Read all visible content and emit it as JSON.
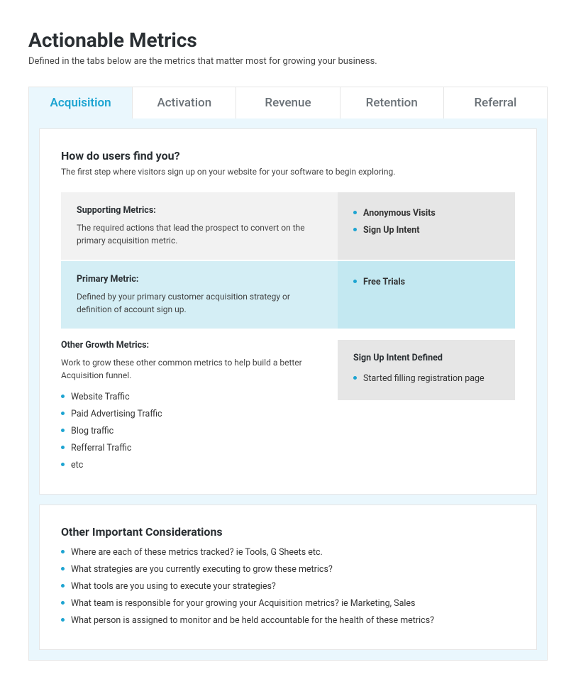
{
  "header": {
    "title": "Actionable Metrics",
    "subtitle": "Defined in the tabs below are the metrics that matter most for growing your business."
  },
  "tabs": [
    {
      "label": "Acquisition",
      "active": true
    },
    {
      "label": "Activation",
      "active": false
    },
    {
      "label": "Revenue",
      "active": false
    },
    {
      "label": "Retention",
      "active": false
    },
    {
      "label": "Referral",
      "active": false
    }
  ],
  "panel1": {
    "heading": "How do users find you?",
    "desc": "The first step where visitors sign up on your website for your software to begin exploring.",
    "supporting": {
      "label": "Supporting Metrics:",
      "text": "The required actions that lead the prospect to convert on the primary acquisition metric.",
      "items": [
        "Anonymous Visits",
        "Sign Up Intent"
      ]
    },
    "primary": {
      "label": "Primary Metric:",
      "text": "Defined by your primary customer acquisition strategy or definition of account sign up.",
      "items": [
        "Free Trials"
      ]
    },
    "growth": {
      "label": "Other Growth Metrics:",
      "text": "Work to grow these other common metrics to help build a better Acquisition funnel.",
      "items": [
        "Website Traffic",
        "Paid Advertising Traffic",
        "Blog traffic",
        "Refferral Traffic",
        "etc"
      ]
    },
    "defined": {
      "label": "Sign Up Intent Defined",
      "items": [
        "Started filling registration page"
      ]
    }
  },
  "panel2": {
    "heading": "Other Important Considerations",
    "items": [
      "Where are each of these metrics tracked? ie Tools, G Sheets etc.",
      "What strategies are you currently executing to grow these metrics?",
      "What tools are you using to execute your strategies?",
      "What team is responsible for your growing your Acquisition metrics? ie Marketing, Sales",
      "What person is assigned to monitor and be held accountable for the health of these metrics?"
    ]
  }
}
